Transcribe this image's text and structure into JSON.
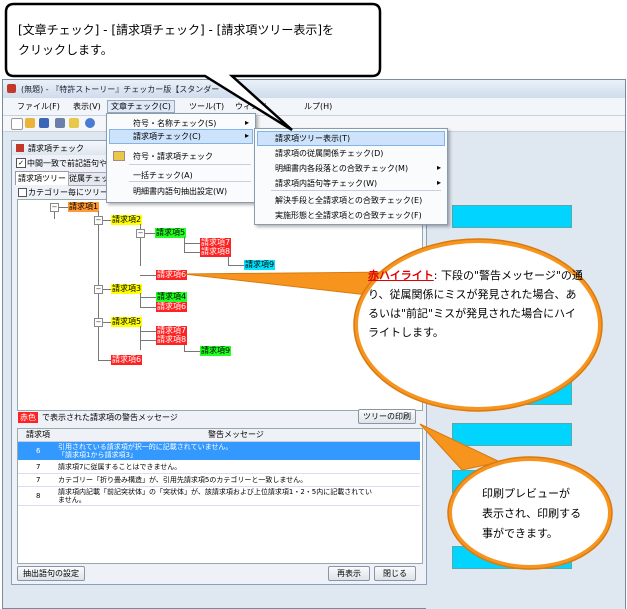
{
  "callout_top": {
    "line1": "[文章チェック] - [請求項チェック] - [請求項ツリー表示]を",
    "line2": "クリックします。"
  },
  "window": {
    "title": "(無題) - 『特許ストーリー』チェッカー版【スタンダー",
    "menus": [
      "ファイル(F)",
      "表示(V)",
      "文章チェック(C)",
      "ツール(T)",
      "ウィンド",
      "ルプ(H)"
    ]
  },
  "menu1": {
    "items": [
      "符号・名称チェック(S)",
      "請求項チェック(C)",
      "符号・請求項チェック",
      "一括チェック(A)",
      "明細書内語句抽出設定(W)"
    ]
  },
  "menu2": {
    "items": [
      "請求項ツリー表示(T)",
      "請求項の従属関係チェック(D)",
      "明細書内各段落との合致チェック(M)",
      "請求項内語句等チェック(W)",
      "解決手段と全請求項との合致チェック(E)",
      "実施形態と全請求項との合致チェック(F)"
    ]
  },
  "subwin": {
    "title": "請求項チェック",
    "check1": "中間一致で前記語句や",
    "tab1": "請求項ツリー",
    "tab2": "従属チェッ",
    "check2": "カテゴリー毎にツリーを",
    "tree": {
      "n1": "請求項1",
      "n2": "請求項2",
      "n5a": "請求項5",
      "n7a": "請求項7",
      "n8a": "請求項8",
      "n9a": "請求項9",
      "n6a": "請求項6",
      "n3": "請求項3",
      "n4": "請求項4",
      "n6b": "請求項6",
      "n5b": "請求項5",
      "n7b": "請求項7",
      "n8b": "請求項8",
      "n9b": "請求項9",
      "n6c": "請求項6"
    },
    "warn_label_red": "赤色",
    "warn_label": "で表示された請求項の警告メッセージ",
    "print_button": "ツリーの印刷",
    "col1": "請求項",
    "col2": "警告メッセージ",
    "rows": [
      {
        "no": "6",
        "msg1": "引用されている請求項が択一的に記載されていません。",
        "msg2": "「請求項1から請求項3」"
      },
      {
        "no": "7",
        "msg1": "請求項7に従属することはできません。",
        "msg2": ""
      },
      {
        "no": "7",
        "msg1": "カテゴリー「折り畳み構造」が、引用先請求項5のカテゴリーと一致しません。",
        "msg2": ""
      },
      {
        "no": "8",
        "msg1": "請求項内記載「前記突状体」の「突状体」が、該請求項および上位請求項1・2・5内に記載されてい",
        "msg2": "ません。"
      }
    ],
    "btn_extract": "抽出語句の設定",
    "btn_redisplay": "再表示",
    "btn_close": "閉じる"
  },
  "callout_red": {
    "title": "赤ハイライト",
    "text": ": 下段の\"警告メッセージ\"の通り、従属関係にミスが発見された場合、あるいは\"前記\"ミスが発見された場合にハイライトします。"
  },
  "callout_print": {
    "line1": "印刷プレビューが",
    "line2": "表示され、印刷する",
    "line3": "事ができます。"
  },
  "colors": {
    "callout_orange": "#f7941d",
    "highlight_red": "#ff2222",
    "highlight_yellow": "#ffff00",
    "highlight_green": "#22ff22",
    "highlight_cyan": "#00e5ff",
    "selected_row": "#3399ff"
  }
}
